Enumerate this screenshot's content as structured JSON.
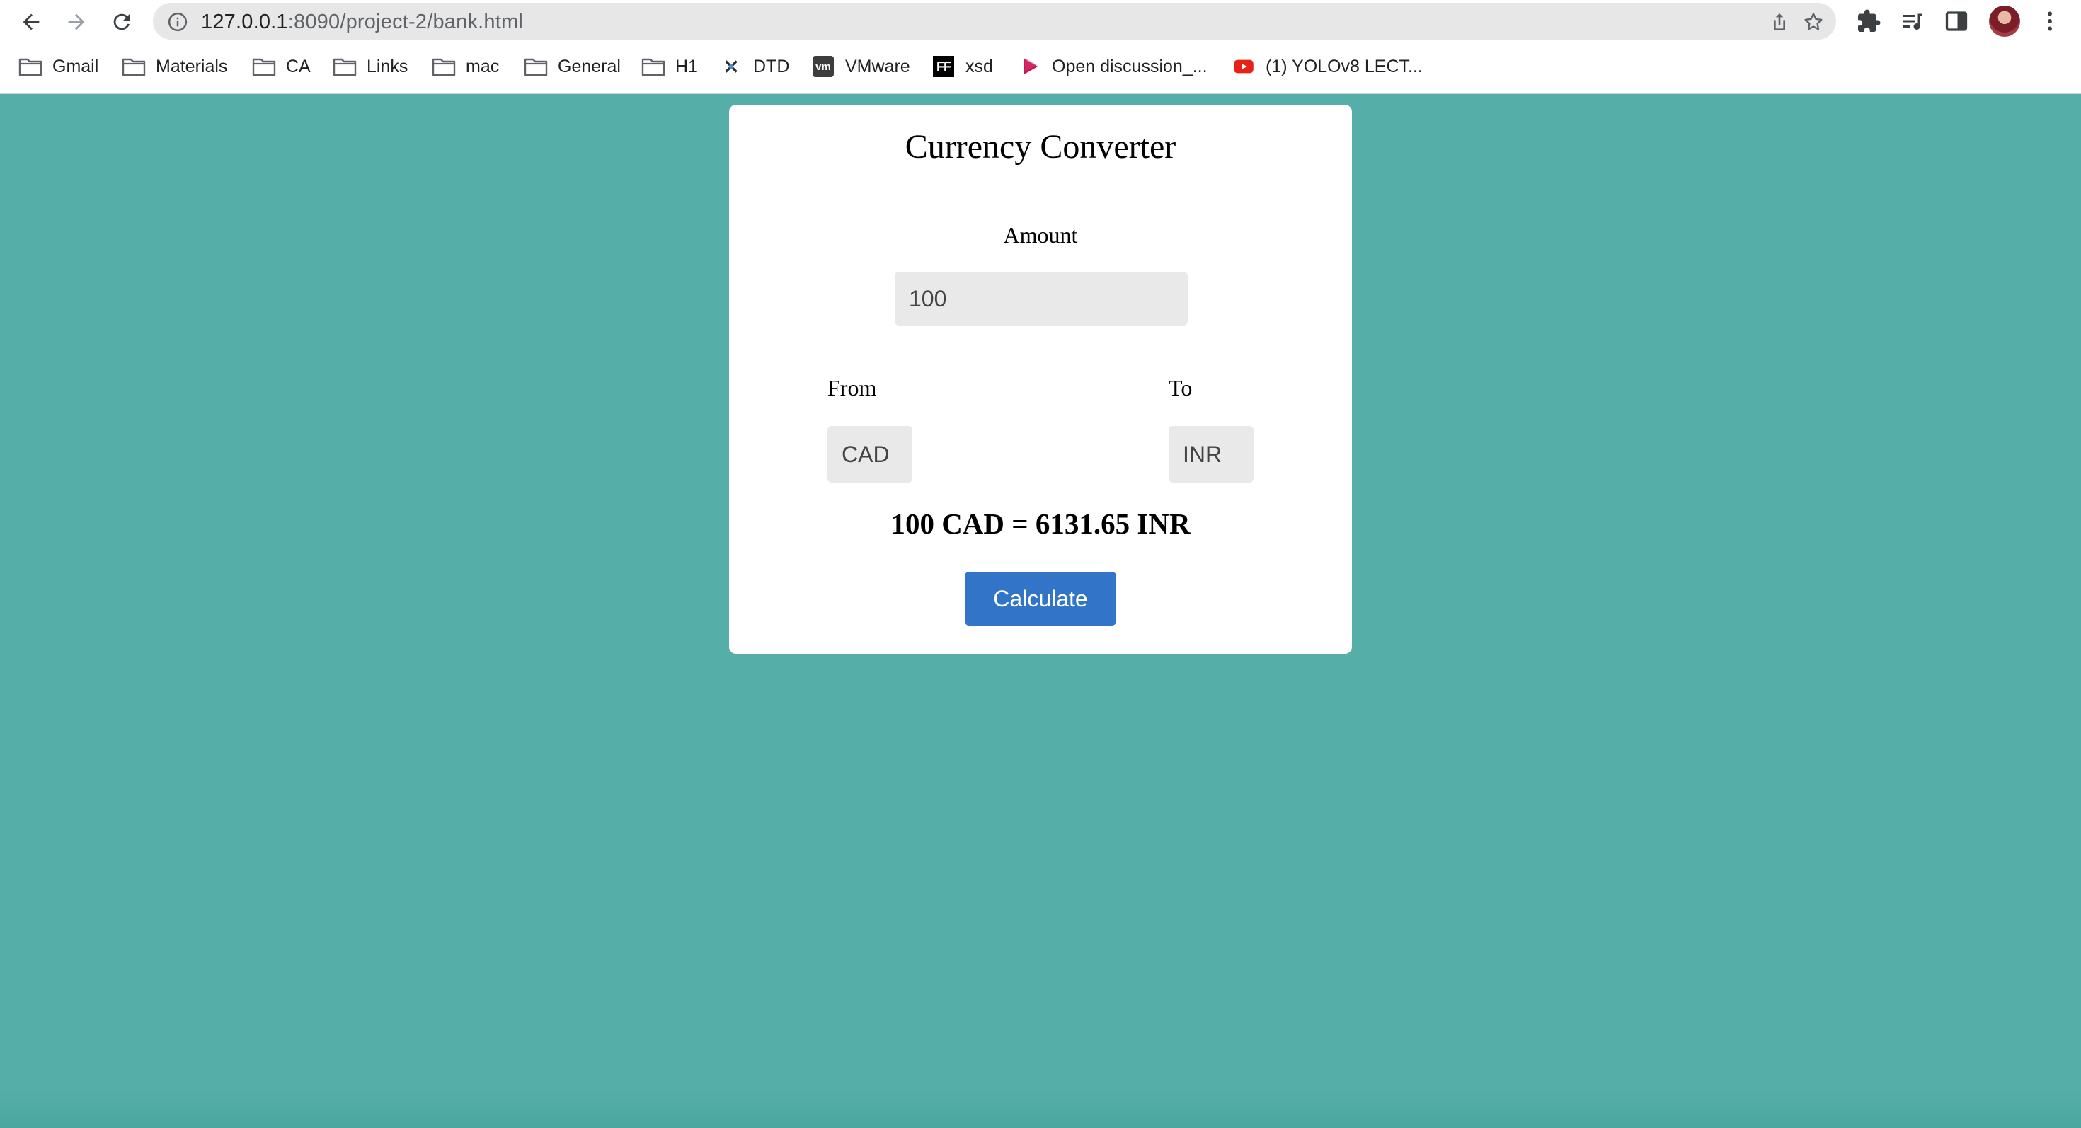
{
  "browser": {
    "url_host": "127.0.0.1",
    "url_rest": ":8090/project-2/bank.html",
    "bookmarks": [
      {
        "label": "Gmail",
        "icon": "folder-icon"
      },
      {
        "label": "Materials",
        "icon": "folder-icon"
      },
      {
        "label": "CA",
        "icon": "folder-icon"
      },
      {
        "label": "Links",
        "icon": "folder-icon"
      },
      {
        "label": "mac",
        "icon": "folder-icon"
      },
      {
        "label": "General",
        "icon": "folder-icon"
      },
      {
        "label": "H1",
        "icon": "folder-icon"
      },
      {
        "label": "DTD",
        "icon": "dtd-favicon"
      },
      {
        "label": "VMware",
        "icon": "vmware-favicon"
      },
      {
        "label": "xsd",
        "icon": "ff-favicon"
      },
      {
        "label": "Open discussion_...",
        "icon": "play-favicon"
      },
      {
        "label": "(1) YOLOv8 LECT...",
        "icon": "youtube-favicon"
      }
    ],
    "vmware_badge": "vm",
    "ff_badge": "FF"
  },
  "converter": {
    "title": "Currency Converter",
    "amount_label": "Amount",
    "amount_value": "100",
    "from_label": "From",
    "from_value": "CAD",
    "to_label": "To",
    "to_value": "INR",
    "result": "100 CAD = 6131.65 INR",
    "calculate_label": "Calculate"
  },
  "colors": {
    "page_background": "#55afa8",
    "button": "#3275c8",
    "input_background": "#e9e9e9"
  }
}
